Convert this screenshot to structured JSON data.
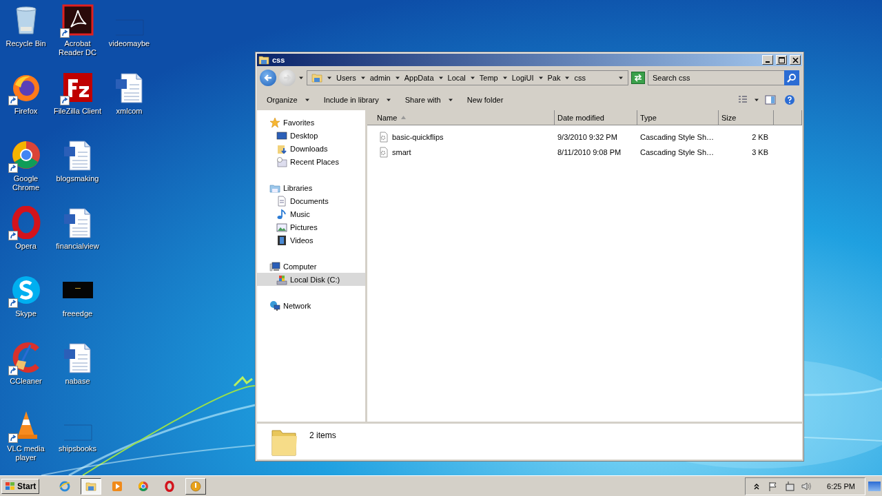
{
  "desktop": {
    "icons": [
      {
        "label": "Recycle Bin",
        "kind": "recycle",
        "shortcut": false
      },
      {
        "label": "Firefox",
        "kind": "firefox",
        "shortcut": true
      },
      {
        "label": "Google Chrome",
        "kind": "chrome",
        "shortcut": true
      },
      {
        "label": "Opera",
        "kind": "opera",
        "shortcut": true
      },
      {
        "label": "Skype",
        "kind": "skype",
        "shortcut": true
      },
      {
        "label": "CCleaner",
        "kind": "ccleaner",
        "shortcut": true
      },
      {
        "label": "VLC media player",
        "kind": "vlc",
        "shortcut": true
      },
      {
        "label": "Acrobat Reader DC",
        "kind": "acrobat",
        "shortcut": true
      },
      {
        "label": "FileZilla Client",
        "kind": "filezilla",
        "shortcut": true
      },
      {
        "label": "blogsmaking",
        "kind": "word",
        "shortcut": false
      },
      {
        "label": "financialview",
        "kind": "word",
        "shortcut": false
      },
      {
        "label": "freeedge",
        "kind": "dark",
        "shortcut": false
      },
      {
        "label": "nabase",
        "kind": "word",
        "shortcut": false
      },
      {
        "label": "shipsbooks",
        "kind": "blank",
        "shortcut": false
      },
      {
        "label": "videomaybe",
        "kind": "blank",
        "shortcut": false
      },
      {
        "label": "xmlcom",
        "kind": "word",
        "shortcut": false
      }
    ]
  },
  "window": {
    "title": "css",
    "breadcrumb": [
      "Users",
      "admin",
      "AppData",
      "Local",
      "Temp",
      "LogiUI",
      "Pak",
      "css"
    ],
    "search": {
      "placeholder": "Search css"
    },
    "commands": [
      {
        "label": "Organize",
        "dropdown": true
      },
      {
        "label": "Include in library",
        "dropdown": true
      },
      {
        "label": "Share with",
        "dropdown": true
      },
      {
        "label": "New folder",
        "dropdown": false
      }
    ],
    "nav": [
      {
        "label": "Favorites",
        "kind": "star",
        "selected": false,
        "children": [
          {
            "label": "Desktop",
            "kind": "desktop",
            "selected": false
          },
          {
            "label": "Downloads",
            "kind": "downloads",
            "selected": false
          },
          {
            "label": "Recent Places",
            "kind": "recent",
            "selected": false
          }
        ]
      },
      {
        "label": "Libraries",
        "kind": "libraries",
        "selected": false,
        "children": [
          {
            "label": "Documents",
            "kind": "documents",
            "selected": false
          },
          {
            "label": "Music",
            "kind": "music",
            "selected": false
          },
          {
            "label": "Pictures",
            "kind": "pictures",
            "selected": false
          },
          {
            "label": "Videos",
            "kind": "videos",
            "selected": false
          }
        ]
      },
      {
        "label": "Computer",
        "kind": "computer",
        "selected": false,
        "children": [
          {
            "label": "Local Disk (C:)",
            "kind": "disk",
            "selected": true
          }
        ]
      },
      {
        "label": "Network",
        "kind": "network",
        "selected": false
      }
    ],
    "columns": [
      {
        "label": "Name",
        "sorted": true
      },
      {
        "label": "Date modified",
        "sorted": false
      },
      {
        "label": "Type",
        "sorted": false
      },
      {
        "label": "Size",
        "sorted": false
      }
    ],
    "files": [
      {
        "name": "basic-quickflips",
        "date_modified": "9/3/2010 9:32 PM",
        "type": "Cascading Style Sh…",
        "size": "2 KB"
      },
      {
        "name": "smart",
        "date_modified": "8/11/2010 9:08 PM",
        "type": "Cascading Style Sh…",
        "size": "3 KB"
      }
    ],
    "item_count": "2 items"
  },
  "taskbar": {
    "start": "Start",
    "apps": [
      {
        "kind": "ie",
        "selected": false,
        "open": false
      },
      {
        "kind": "explorer",
        "selected": true,
        "open": true
      },
      {
        "kind": "wmp",
        "selected": false,
        "open": false
      },
      {
        "kind": "chrome",
        "selected": false,
        "open": false
      },
      {
        "kind": "opera",
        "selected": false,
        "open": false
      },
      {
        "kind": "app",
        "selected": false,
        "open": true
      }
    ],
    "clock": "6:25 PM"
  }
}
